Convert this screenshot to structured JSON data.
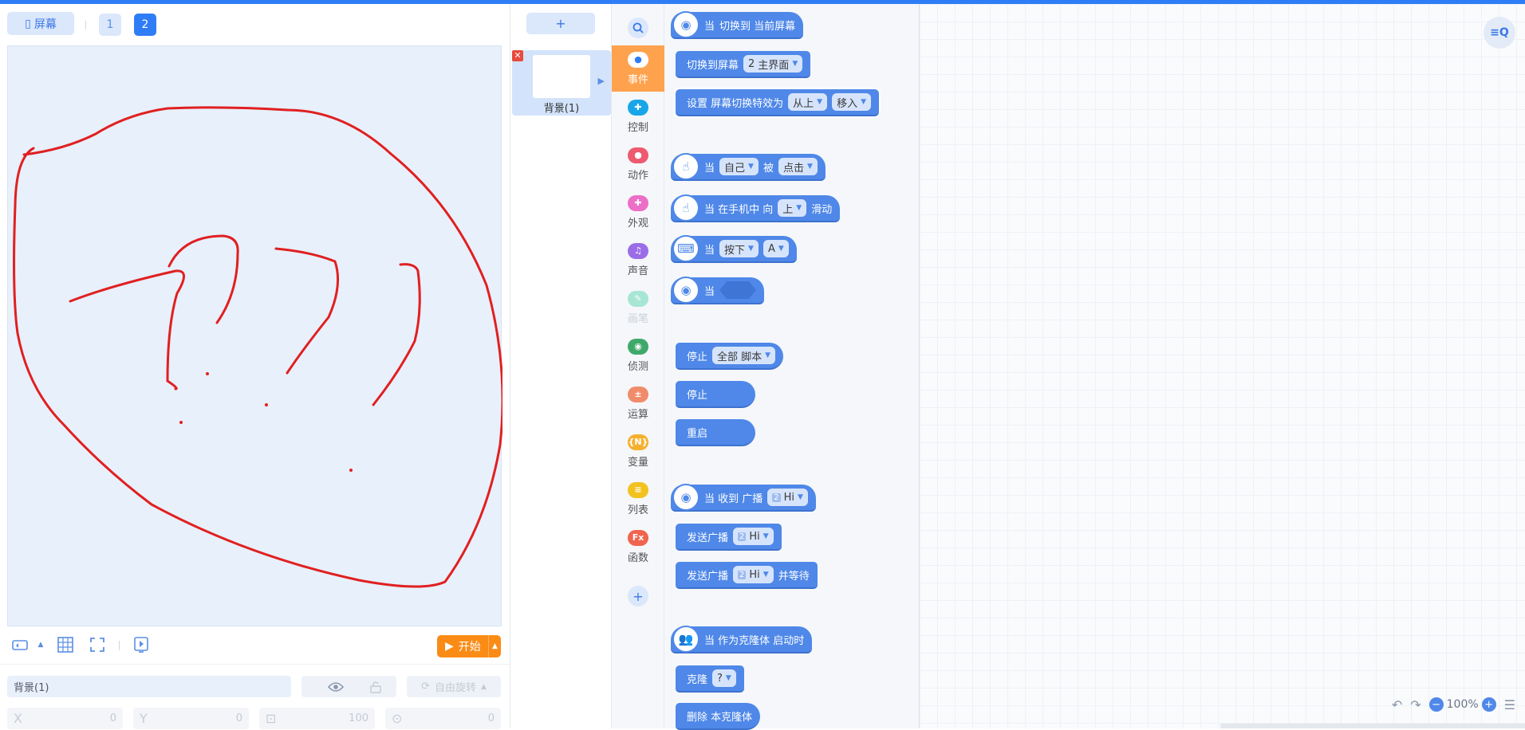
{
  "stage": {
    "screen_label": "屏幕",
    "pages": [
      "1",
      "2"
    ],
    "start_label": "开始"
  },
  "properties": {
    "name": "背景(1)",
    "rotation_label": "自由旋转",
    "x_label": "X",
    "x_value": "0",
    "y_label": "Y",
    "y_value": "0",
    "size_value": "100",
    "direction_value": "0"
  },
  "sprites": {
    "add_label": "+",
    "items": [
      {
        "label": "背景(1)"
      }
    ]
  },
  "categories": [
    {
      "label": "事件",
      "color": "#2f7df6",
      "active": true
    },
    {
      "label": "控制",
      "color": "#19a6e8"
    },
    {
      "label": "动作",
      "color": "#ee5a6f"
    },
    {
      "label": "外观",
      "color": "#ec6fc7"
    },
    {
      "label": "声音",
      "color": "#9b6ee8"
    },
    {
      "label": "画笔",
      "color": "#a7e6d3",
      "faded": true
    },
    {
      "label": "侦测",
      "color": "#3fa96a"
    },
    {
      "label": "运算",
      "color": "#f08c6b"
    },
    {
      "label": "变量",
      "color": "#f5b02e"
    },
    {
      "label": "列表",
      "color": "#f2c21e"
    },
    {
      "label": "函数",
      "color": "#f1644f"
    }
  ],
  "blocks": {
    "b1": {
      "t1": "当",
      "t2": "切换到 当前屏幕"
    },
    "b2": {
      "t1": "切换到屏幕",
      "num": "2",
      "dd": "主界面"
    },
    "b3": {
      "t1": "设置 屏幕切换特效为",
      "dd1": "从上",
      "dd2": "移入"
    },
    "b4": {
      "t1": "当",
      "dd1": "自己",
      "t2": "被",
      "dd2": "点击"
    },
    "b5": {
      "t1": "当 在手机中 向",
      "dd": "上",
      "t2": "滑动"
    },
    "b6": {
      "t1": "当",
      "dd1": "按下",
      "dd2": "A"
    },
    "b7": {
      "t1": "当"
    },
    "b8": {
      "t1": "停止",
      "dd": "全部 脚本"
    },
    "b9": {
      "t1": "停止"
    },
    "b10": {
      "t1": "重启"
    },
    "b11": {
      "t1": "当 收到 广播",
      "num": "2",
      "dd": "Hi"
    },
    "b12": {
      "t1": "发送广播",
      "num": "2",
      "dd": "Hi"
    },
    "b13": {
      "t1": "发送广播",
      "num": "2",
      "dd": "Hi",
      "t2": "并等待"
    },
    "b14": {
      "t1": "当 作为克隆体 启动时"
    },
    "b15": {
      "t1": "克隆",
      "dd": "?"
    },
    "b16": {
      "t1": "删除 本克隆体"
    }
  },
  "workspace": {
    "zoom": "100%"
  },
  "icons": {
    "search": "search-icon",
    "eye": "eye-icon",
    "lock": "lock-icon",
    "grid": "grid-icon",
    "fullscreen": "fullscreen-icon",
    "phone": "phone-preview-icon",
    "undo": "undo-icon",
    "redo": "redo-icon"
  },
  "colors": {
    "accent": "#2f7df6",
    "block": "#4f88e8",
    "start": "#fa8c16",
    "drawing": "#e02020",
    "active_category": "#ffa24d"
  }
}
